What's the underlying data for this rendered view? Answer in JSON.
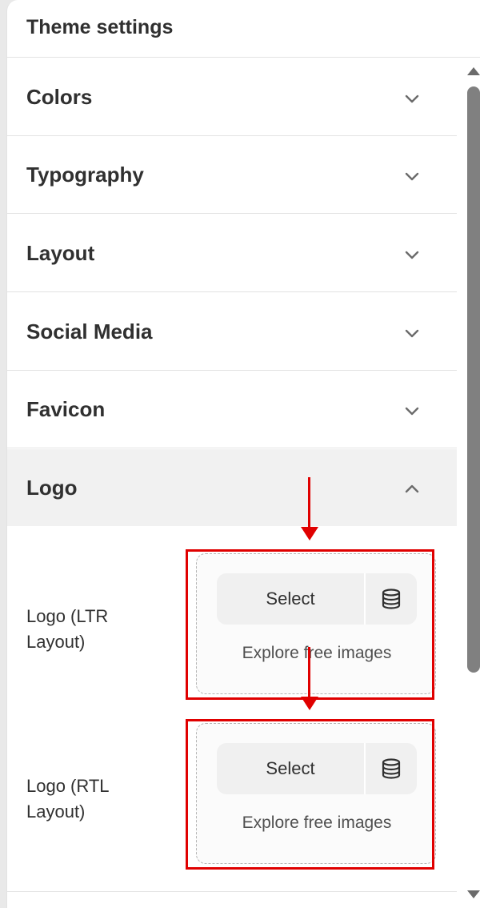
{
  "header": {
    "title": "Theme settings"
  },
  "sections": [
    {
      "label": "Colors",
      "expanded": false
    },
    {
      "label": "Typography",
      "expanded": false
    },
    {
      "label": "Layout",
      "expanded": false
    },
    {
      "label": "Social Media",
      "expanded": false
    },
    {
      "label": "Favicon",
      "expanded": false
    },
    {
      "label": "Logo",
      "expanded": true
    }
  ],
  "logo_fields": [
    {
      "label": "Logo (LTR Layout)",
      "select_label": "Select",
      "library_icon": "database-icon",
      "explore_label": "Explore free images"
    },
    {
      "label": "Logo (RTL Layout)",
      "select_label": "Select",
      "library_icon": "database-icon",
      "explore_label": "Explore free images"
    }
  ],
  "icons": {
    "collapsed": "chevron-down-icon",
    "expanded": "chevron-up-icon"
  },
  "colors": {
    "annotation": "#e00000",
    "expanded_section_bg": "#f1f1f1",
    "button_bg": "#f0f0f0"
  }
}
